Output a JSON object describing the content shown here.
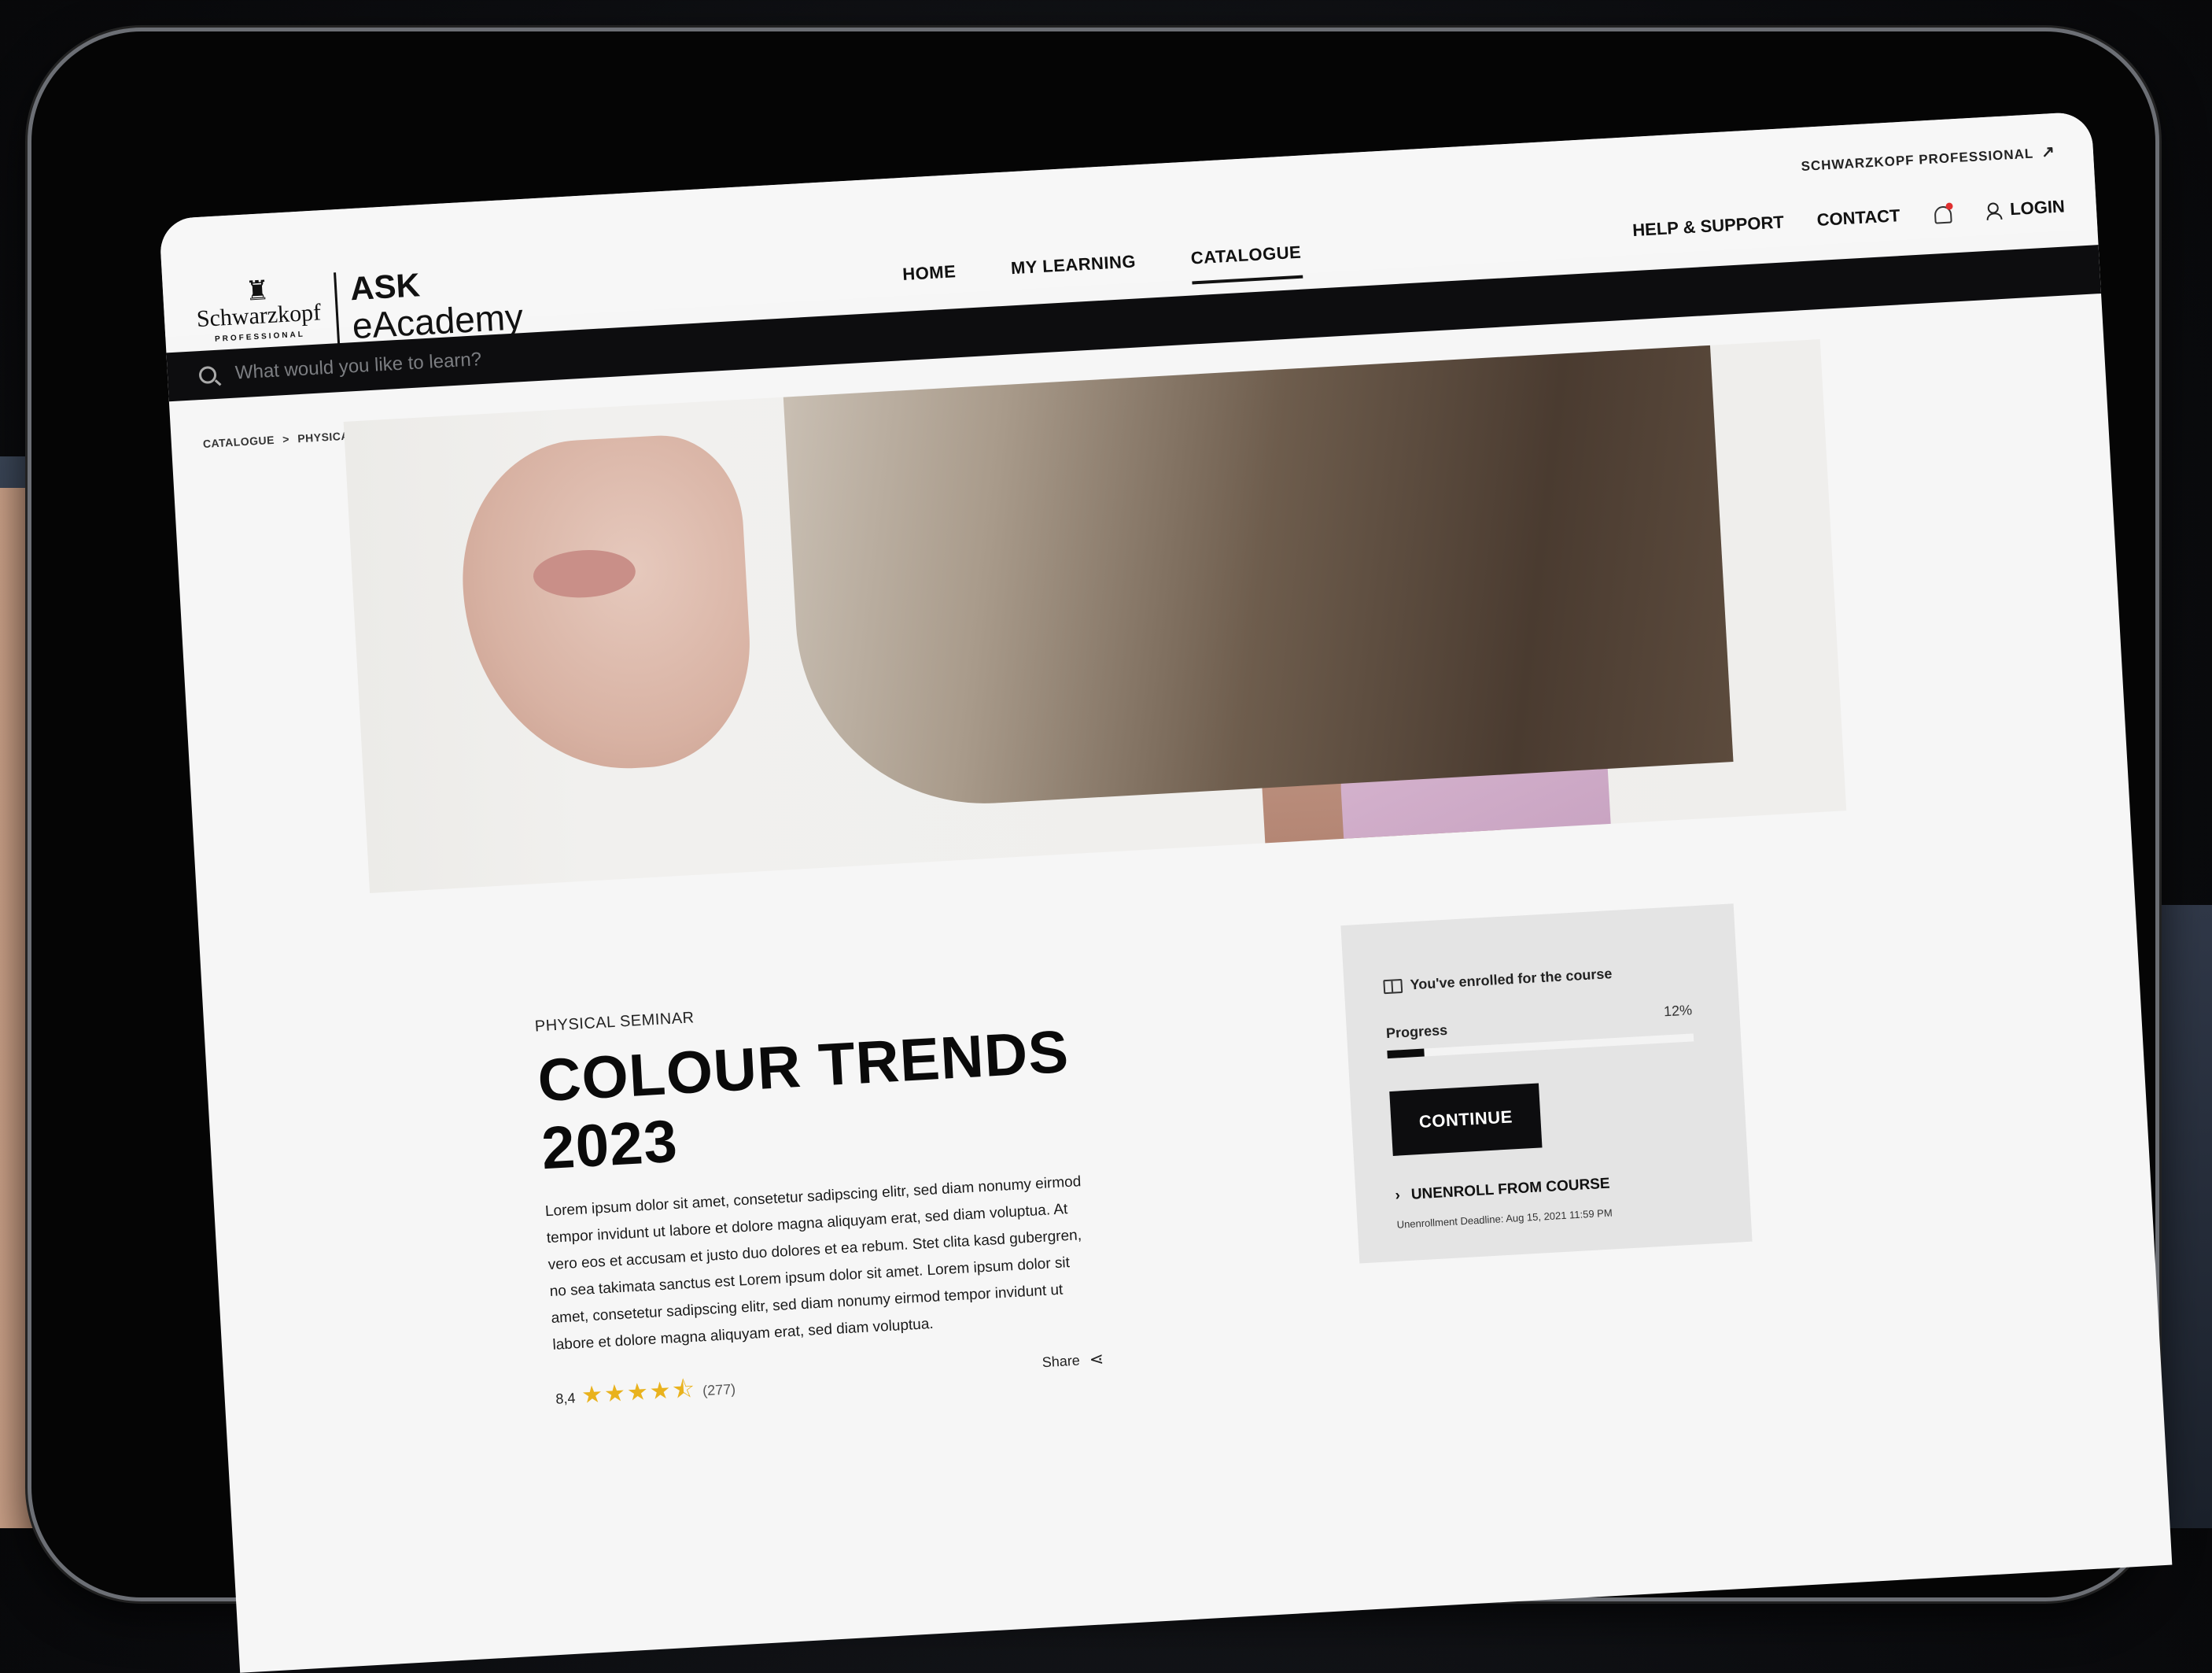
{
  "header": {
    "utility_link": "SCHWARZKOPF PROFESSIONAL",
    "brand": {
      "name": "Schwarzkopf",
      "sub": "PROFESSIONAL"
    },
    "product_line1": "ASK",
    "product_line2": "eAcademy",
    "nav": [
      {
        "label": "HOME",
        "active": false
      },
      {
        "label": "MY LEARNING",
        "active": false
      },
      {
        "label": "CATALOGUE",
        "active": true
      }
    ],
    "right_nav": {
      "help": "HELP & SUPPORT",
      "contact": "CONTACT",
      "login": "LOGIN"
    }
  },
  "search": {
    "placeholder": "What would you like to learn?"
  },
  "breadcrumb": {
    "item1": "CATALOGUE",
    "separator": ">",
    "item2": "PHYSICAL SEMINAR"
  },
  "course": {
    "type": "PHYSICAL SEMINAR",
    "title": "COLOUR TRENDS 2023",
    "description": "Lorem ipsum dolor sit amet, consetetur sadipscing elitr, sed diam nonumy eirmod tempor invidunt ut labore et dolore magna aliquyam erat, sed diam voluptua. At vero eos et accusam et justo duo dolores et ea rebum. Stet clita kasd gubergren, no sea takimata sanctus est Lorem ipsum dolor sit amet. Lorem ipsum dolor sit amet, consetetur sadipscing elitr, sed diam nonumy eirmod tempor invidunt ut labore et dolore magna aliquyam erat, sed diam voluptua.",
    "rating": "8,4",
    "rating_count": "(277)",
    "stars": "★★★★⯪",
    "share": "Share"
  },
  "enrollment": {
    "status": "You've enrolled for the course",
    "progress_label": "Progress",
    "progress_text": "12%",
    "progress": 0.12,
    "continue": "CONTINUE",
    "unenroll": "UNENROLL FROM COURSE",
    "deadline": "Unenrollment Deadline: Aug 15, 2021  11:59 PM"
  }
}
